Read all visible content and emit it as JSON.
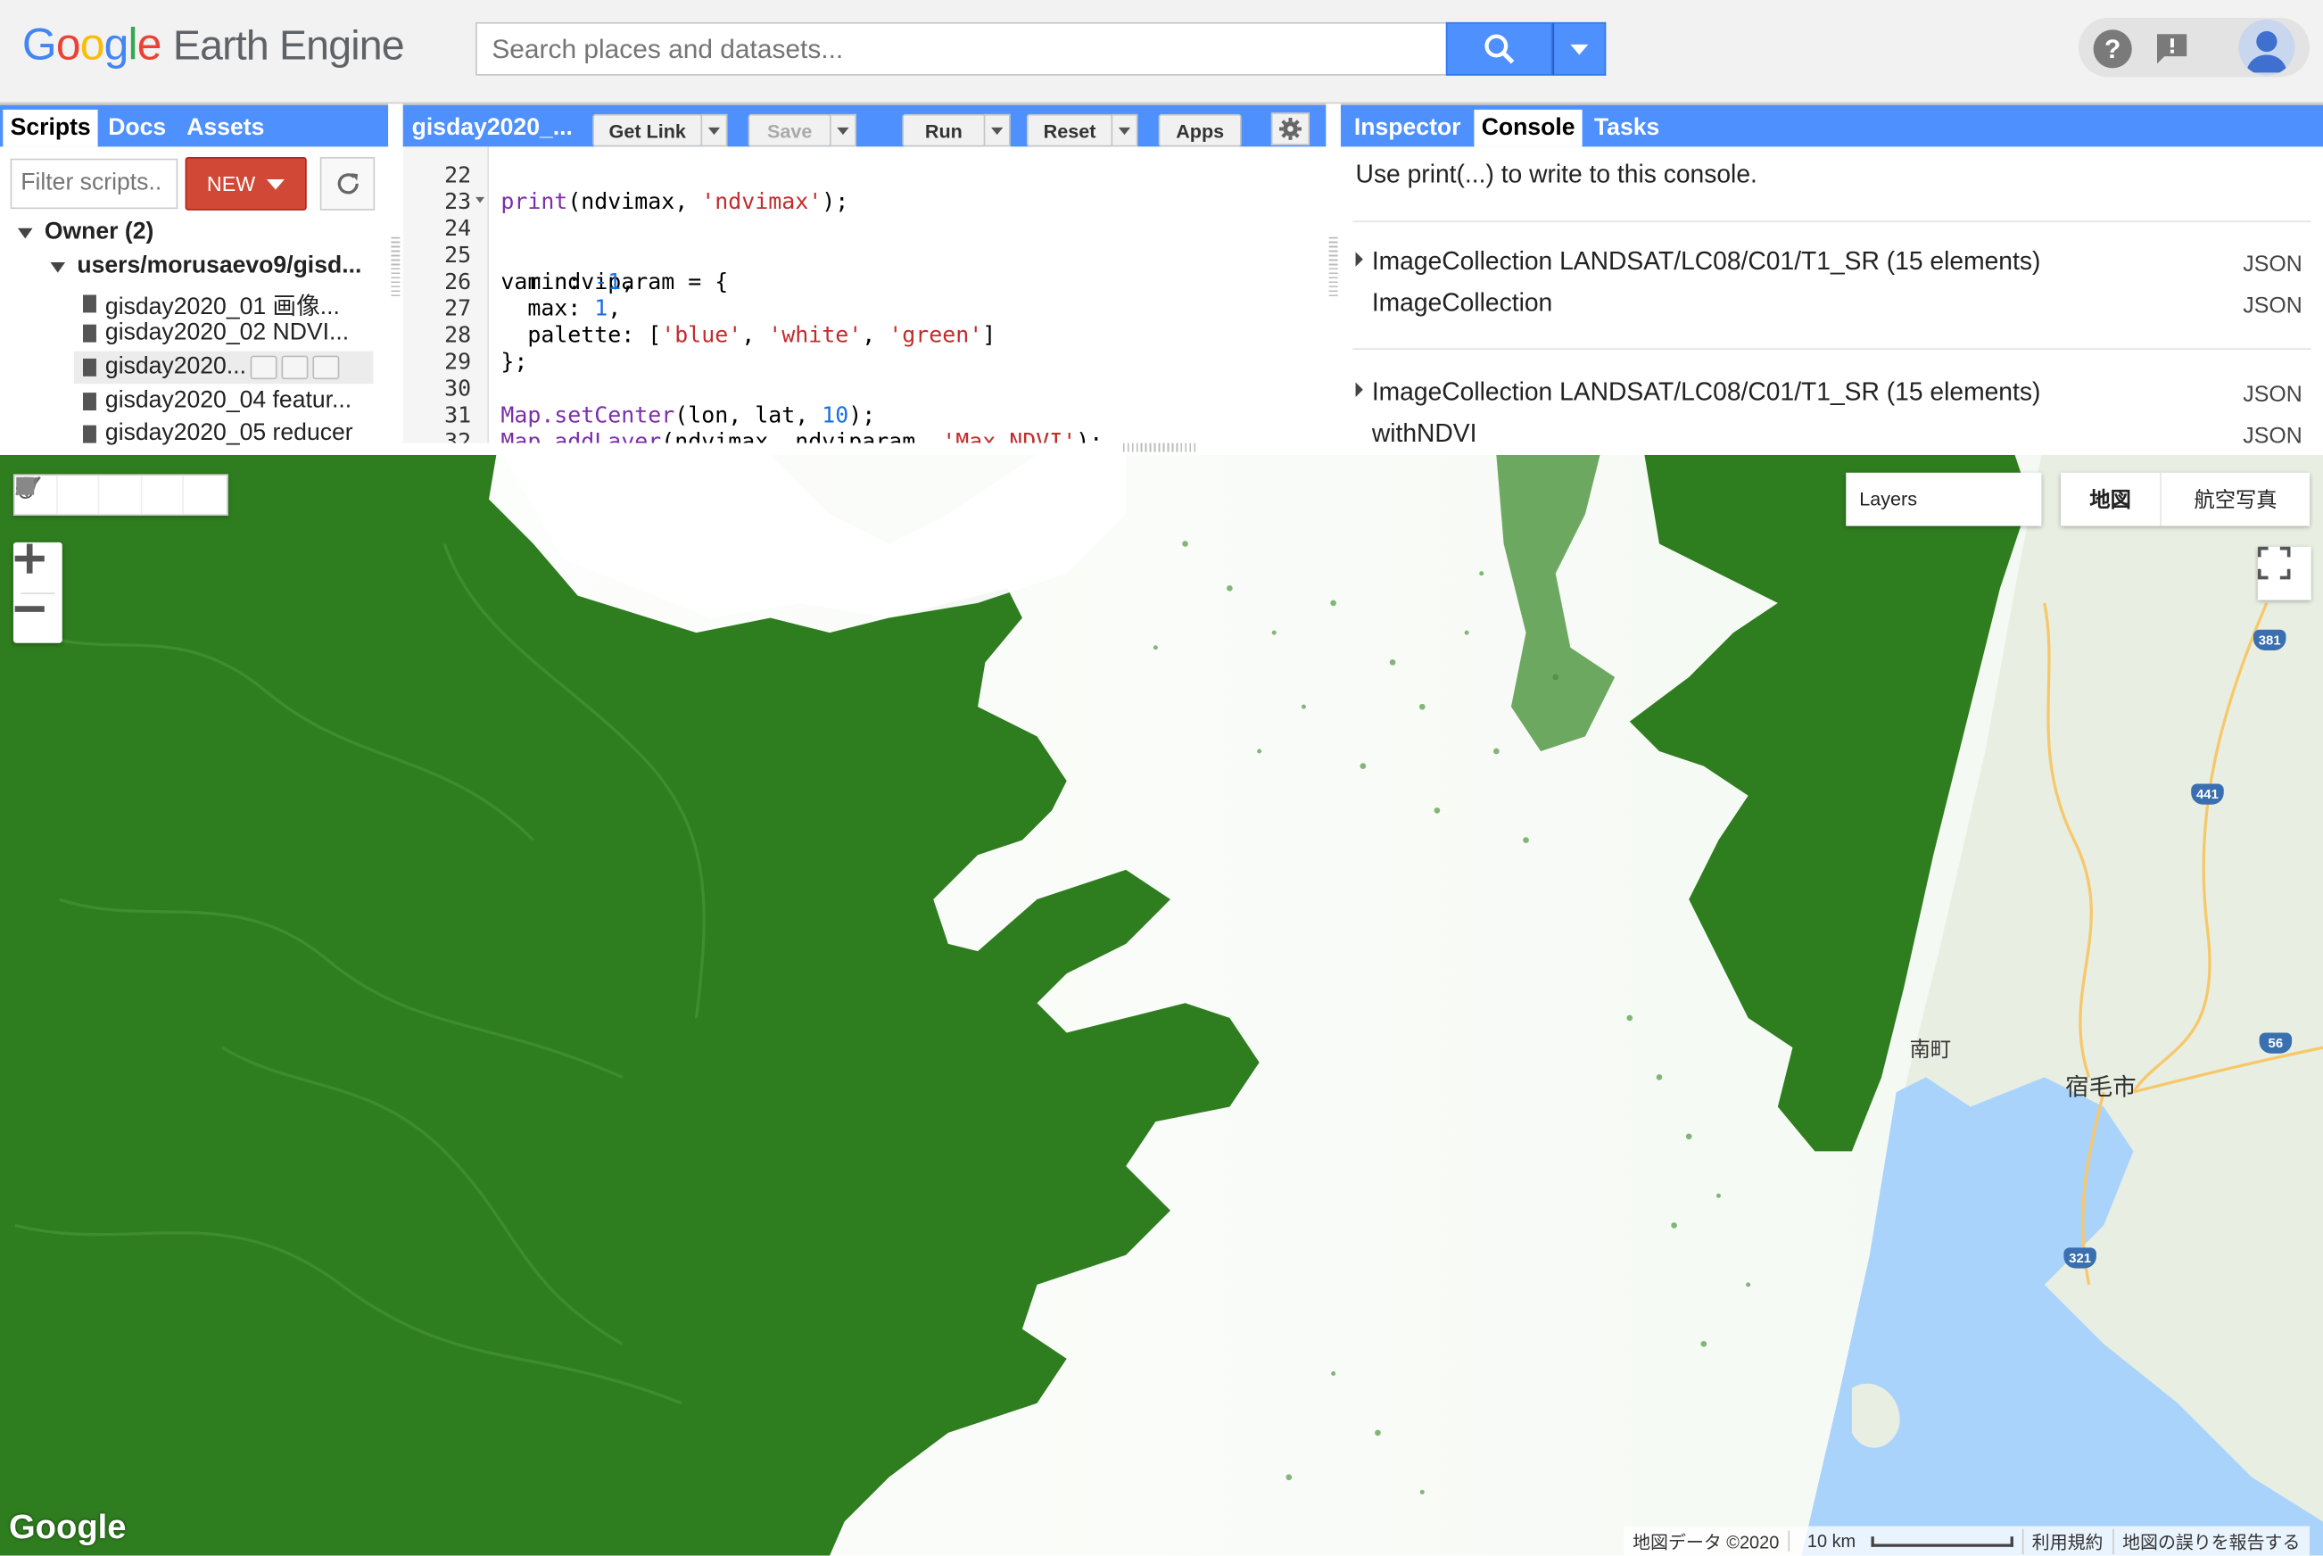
{
  "header": {
    "logo_google": [
      "G",
      "o",
      "o",
      "g",
      "l",
      "e"
    ],
    "logo_colors": [
      "#4285F4",
      "#EA4335",
      "#FBBC05",
      "#4285F4",
      "#34A853",
      "#EA4335"
    ],
    "logo_product": "Earth Engine",
    "search_placeholder": "Search places and datasets...",
    "icons": [
      "search-icon",
      "chevron-down-icon",
      "help-icon",
      "feedback-icon",
      "account-icon"
    ]
  },
  "scripts_panel": {
    "tabs": [
      "Scripts",
      "Docs",
      "Assets"
    ],
    "active_tab": "Scripts",
    "filter_placeholder": "Filter scripts..",
    "new_label": "NEW",
    "tree": {
      "owner_label": "Owner",
      "owner_count": "(2)",
      "repo": "users/morusaevo9/gisd...",
      "files": [
        "gisday2020_01 画像...",
        "gisday2020_02 NDVI...",
        "gisday2020...",
        "gisday2020_04 featur...",
        "gisday2020_05 reducer"
      ],
      "selected_index": 2
    }
  },
  "editor": {
    "title": "gisday2020_...",
    "buttons": {
      "get_link": "Get Link",
      "save": "Save",
      "run": "Run",
      "reset": "Reset",
      "apps": "Apps"
    },
    "line_numbers": [
      "22",
      "23",
      "24",
      "25",
      "26",
      "27",
      "28",
      "29",
      "30",
      "31",
      "32"
    ],
    "lines": {
      "l22": {
        "a": "print",
        "b": "(ndvimax, ",
        "c": "'ndvimax'",
        "d": ");"
      },
      "l24": "var ndviparam = {",
      "l25": {
        "a": "  min: ",
        "b": "-1",
        "c": ","
      },
      "l26": {
        "a": "  max: ",
        "b": "1",
        "c": ","
      },
      "l27": {
        "a": "  palette: [",
        "b": "'blue'",
        "c": ", ",
        "d": "'white'",
        "e": ", ",
        "f": "'green'",
        "g": "]"
      },
      "l28": "};",
      "l30": {
        "a": "Map.setCenter",
        "b": "(lon, lat, ",
        "c": "10",
        "d": ");"
      },
      "l31": {
        "a": "Map.addLayer",
        "b": "(ndvimax, ndviparam, ",
        "c": "'Max NDVI'",
        "d": ");"
      }
    }
  },
  "console_panel": {
    "tabs": [
      "Inspector",
      "Console",
      "Tasks"
    ],
    "active_tab": "Console",
    "message": "Use print(...) to write to this console.",
    "items": [
      {
        "label": "ImageCollection LANDSAT/LC08/C01/T1_SR (15 elements)",
        "link": "JSON"
      },
      {
        "label": "ImageCollection",
        "link": "JSON"
      },
      {
        "label": "ImageCollection LANDSAT/LC08/C01/T1_SR (15 elements)",
        "link": "JSON"
      },
      {
        "label": "withNDVI",
        "link": "JSON"
      }
    ]
  },
  "map": {
    "layers_label": "Layers",
    "map_types": [
      "地図",
      "航空写真"
    ],
    "watermark": "Google",
    "attribution": "地図データ ©2020",
    "scale": "10 km",
    "terms": "利用規約",
    "report": "地図の誤りを報告する",
    "place_labels": [
      "南町",
      "宿毛市"
    ],
    "route_shields": [
      "381",
      "441",
      "56",
      "321"
    ],
    "colors": {
      "ndvi_green": "#2e7d1f",
      "water": "#aad3fb",
      "land": "#e8efe2"
    }
  }
}
